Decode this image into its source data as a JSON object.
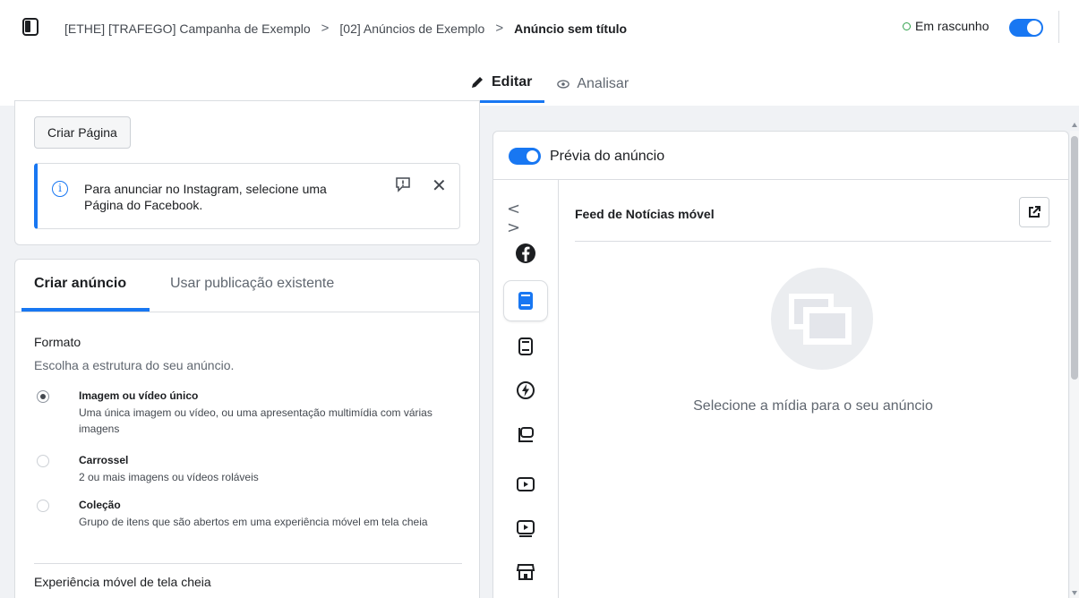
{
  "header": {
    "breadcrumb": {
      "campaign": "[ETHE] [TRAFEGO] Campanha de Exemplo",
      "adset": "[02] Anúncios de Exemplo",
      "ad": "Anúncio sem título",
      "separator": ">"
    },
    "status_label": "Em rascunho",
    "status_on": true,
    "mode_tabs": [
      {
        "label": "Editar",
        "icon": "pencil-icon",
        "active": true
      },
      {
        "label": "Analisar",
        "icon": "eye-icon",
        "active": false
      }
    ]
  },
  "identity": {
    "create_page_button": "Criar Página",
    "notice_text": "Para anunciar no Instagram, selecione uma Página do Facebook."
  },
  "ad_setup": {
    "tabs": [
      {
        "label": "Criar anúncio",
        "active": true
      },
      {
        "label": "Usar publicação existente",
        "active": false
      }
    ],
    "format_title": "Formato",
    "format_subtitle": "Escolha a estrutura do seu anúncio.",
    "options": [
      {
        "label": "Imagem ou vídeo único",
        "desc": "Uma única imagem ou vídeo, ou uma apresentação multimídia com várias imagens",
        "selected": true
      },
      {
        "label": "Carrossel",
        "desc": "2 ou mais imagens ou vídeos roláveis",
        "selected": false
      },
      {
        "label": "Coleção",
        "desc": "Grupo de itens que são abertos em uma experiência móvel em tela cheia",
        "selected": false
      }
    ],
    "next_section_title": "Experiência móvel de tela cheia"
  },
  "preview": {
    "title": "Prévia do anúncio",
    "enabled": true,
    "arrows": "< >",
    "placements": [
      {
        "icon": "facebook-icon",
        "active": false
      },
      {
        "icon": "mobile-feed-icon",
        "active": true
      },
      {
        "icon": "desktop-feed-icon",
        "active": false
      },
      {
        "icon": "instant-articles-icon",
        "active": false
      },
      {
        "icon": "marketplace-icon",
        "active": false
      },
      {
        "icon": "video-feed-icon",
        "active": false
      },
      {
        "icon": "in-stream-video-icon",
        "active": false
      },
      {
        "icon": "store-icon",
        "active": false
      }
    ],
    "placement_title": "Feed de Notícias móvel",
    "empty_text": "Selecione a mídia para o seu anúncio"
  },
  "colors": {
    "accent": "#1877f2",
    "status_green": "#31a24c",
    "background": "#f0f2f5"
  }
}
